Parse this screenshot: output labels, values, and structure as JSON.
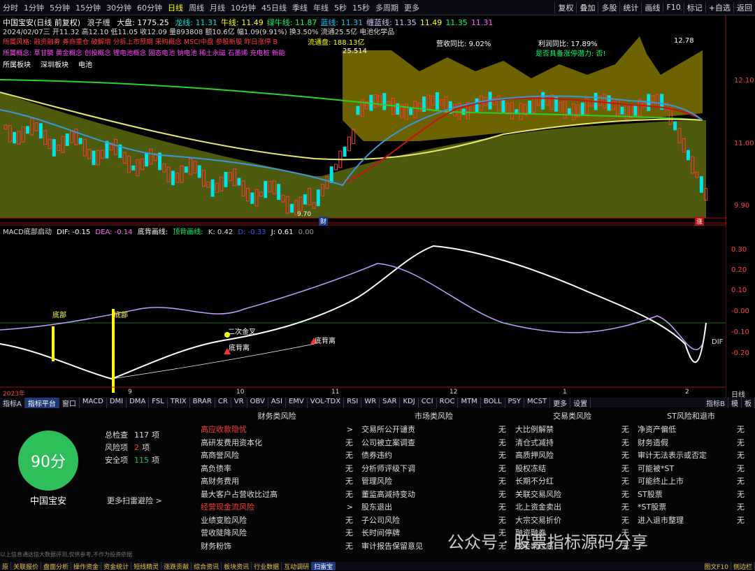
{
  "topbar": {
    "periods": [
      "分时",
      "1分钟",
      "5分钟",
      "15分钟",
      "30分钟",
      "60分钟",
      "日线",
      "周线",
      "月线",
      "10分钟",
      "45日线",
      "季线",
      "年线",
      "5秒",
      "15秒",
      "多周期",
      "更多"
    ],
    "active_period": "日线",
    "right_buttons": [
      "复权",
      "叠加",
      "多股",
      "统计",
      "画线",
      "F10",
      "标记",
      "+自选",
      "返回"
    ]
  },
  "chart": {
    "title": "中国宝安(日线 前复权)",
    "indicator": "浪子缠",
    "dapan": "大盘: 1775.25",
    "lines": [
      {
        "label": "龙线: 11.31",
        "color": "#00e0e0"
      },
      {
        "label": "牛线: 11.49",
        "color": "#ffff00"
      },
      {
        "label": "绿牛线: 11.87",
        "color": "#00ff66"
      },
      {
        "label": "蓝线: 11.31",
        "color": "#00ccff"
      },
      {
        "label": "缠蓝线: 11.35",
        "color": "#ccccff"
      },
      {
        "label": "11.49",
        "color": "#ffff00"
      },
      {
        "label": "11.35",
        "color": "#00ff66"
      },
      {
        "label": "11.31",
        "color": "#ff66ff"
      }
    ],
    "quote_line": "2024/02/07三  开11.32 高12.10 低11.05 收12.09 量893808 额10.6亿 幅1.09(9.91%) 换3.50% 流通25.5亿 电池化学品",
    "risk_tags": "所属风格: 融资融券 券商重仓 破解增 分拆上市预期 采购概念 MSCI中盘 参股新股 昨日涨停 B",
    "concept_tags": "所属概念: 草甘膦 黄金概念 创投概念 锂电池概念 固态电池 钠电池 稀土永磁 石墨烯 充电桩 新能",
    "board_tags": [
      "所属板块",
      "深圳板块",
      "电池"
    ],
    "circulating": "流通盘: 188.13亿",
    "circ_value": "25.514",
    "revenue_yoy": "营收同比: 9.02%",
    "profit_yoy": "利润同比: 17.89%",
    "potential": "是否具备涨停潜力: 否!",
    "price_ticks": [
      "12.10",
      "11.00",
      "9.90"
    ],
    "high_label": "12.78",
    "low_label": "9.70",
    "cai_marker": "财",
    "zhang_marker": "涨"
  },
  "sub_chart": {
    "name": "MACD底部启动",
    "dif": "DIF: -0.15",
    "dea": "DEA: -0.14",
    "dibei": "底背画线:",
    "tibei": "顶背画线:",
    "k": "K: 0.42",
    "d": "D: -0.33",
    "j": "J: 0.61",
    "extra": "0.00",
    "ticks": [
      "0.30",
      "0.20",
      "0.10",
      "-0.00",
      "-0.10",
      "-0.20"
    ],
    "dates": [
      "2023年",
      "9",
      "10",
      "11",
      "12",
      "1",
      "2"
    ],
    "labels": {
      "dibu1": "底部",
      "dibu2": "底部",
      "ercijincha": "二次金叉",
      "dibeili1": "底背离",
      "dibeili2": "底背离",
      "dif_tag": "DIF",
      "day_label": "日线"
    }
  },
  "indicator_tabs": [
    "指标A",
    "指标平台",
    "窗口",
    "MACD",
    "DMI",
    "DMA",
    "FSL",
    "TRIX",
    "BRAR",
    "CR",
    "VR",
    "OBV",
    "ASI",
    "EMV",
    "VOL-TDX",
    "RSI",
    "WR",
    "SAR",
    "KDJ",
    "CCI",
    "ROC",
    "MTM",
    "BOLL",
    "PSY",
    "MCST",
    "更多",
    "设置"
  ],
  "indicator_tabs_right": [
    "指标B",
    "模",
    "板"
  ],
  "panel": {
    "score": "90分",
    "stock_name": "中国宝安",
    "summary": [
      {
        "label": "总检查",
        "value": "117",
        "unit": "项",
        "color": "#ddd"
      },
      {
        "label": "风险项",
        "value": "2",
        "unit": "项",
        "color": "#ff3b30"
      },
      {
        "label": "安全项",
        "value": "115",
        "unit": "项",
        "color": "#2fbf5a"
      }
    ],
    "more": "更多扫雷避险 >",
    "disclaimer": "以上信息通达信大数据评测,仅供参考,不作为投资依据",
    "columns": [
      {
        "title": "财务类风险",
        "items": [
          {
            "label": "高应收款隐忧",
            "value": ">",
            "warn": true
          },
          {
            "label": "高研发费用资本化",
            "value": "无"
          },
          {
            "label": "高商誉风险",
            "value": "无"
          },
          {
            "label": "高负债率",
            "value": "无"
          },
          {
            "label": "高财务费用",
            "value": "无"
          },
          {
            "label": "最大客户占营收比过高",
            "value": "无"
          },
          {
            "label": "经营现金流风险",
            "value": ">",
            "warn": true
          },
          {
            "label": "业绩变脸风险",
            "value": "无"
          },
          {
            "label": "营收陡降风险",
            "value": "无"
          },
          {
            "label": "财务粉饰",
            "value": "无"
          }
        ]
      },
      {
        "title": "市场类风险",
        "items": [
          {
            "label": "交易所公开谴责",
            "value": "无"
          },
          {
            "label": "公司被立案调查",
            "value": "无"
          },
          {
            "label": "债券违约",
            "value": "无"
          },
          {
            "label": "分析师评级下调",
            "value": "无"
          },
          {
            "label": "管理风险",
            "value": "无"
          },
          {
            "label": "董监高減持变动",
            "value": "无"
          },
          {
            "label": "股东退出",
            "value": "无"
          },
          {
            "label": "子公司风险",
            "value": "无"
          },
          {
            "label": "长时间停牌",
            "value": "无"
          },
          {
            "label": "审计报告保留意见",
            "value": "无"
          }
        ]
      },
      {
        "title": "交易类风险",
        "items": [
          {
            "label": "大比例解禁",
            "value": "无"
          },
          {
            "label": "清仓式减持",
            "value": "无"
          },
          {
            "label": "高质押风险",
            "value": "无"
          },
          {
            "label": "股权冻结",
            "value": "无"
          },
          {
            "label": "长期不分红",
            "value": "无"
          },
          {
            "label": "关联交易风险",
            "value": "无"
          },
          {
            "label": "北上资金卖出",
            "value": "无"
          },
          {
            "label": "大宗交易折价",
            "value": "无"
          },
          {
            "label": "融资融券",
            "value": "无"
          },
          {
            "label": "换手率过高",
            "value": "无"
          }
        ]
      },
      {
        "title": "ST风险和退市",
        "items": [
          {
            "label": "净资产偏低",
            "value": "无"
          },
          {
            "label": "财务造假",
            "value": "无"
          },
          {
            "label": "审计无法表示或否定",
            "value": "无"
          },
          {
            "label": "可能被*ST",
            "value": "无"
          },
          {
            "label": "可能终止上市",
            "value": "无"
          },
          {
            "label": "ST股票",
            "value": "无"
          },
          {
            "label": "*ST股票",
            "value": "无"
          },
          {
            "label": "进入退市整理",
            "value": "无"
          }
        ]
      }
    ]
  },
  "watermark": "公众号 · 股票指标源码分享",
  "footer_tabs": [
    "原",
    "关联报价",
    "盘面分析",
    "操作资金",
    "资金统计",
    "短线精灵",
    "涨跌贡献",
    "综合资讯",
    "板块资讯",
    "行业数据",
    "互动调研",
    "扫雷宝"
  ],
  "footer_active": "扫雷宝",
  "footer_right": [
    "图文F10",
    "侧边栏"
  ],
  "colors": {
    "up": "#ff3b3b",
    "down": "#00e5e5",
    "score": "#2fbf5a",
    "warn": "#ff3b30"
  }
}
